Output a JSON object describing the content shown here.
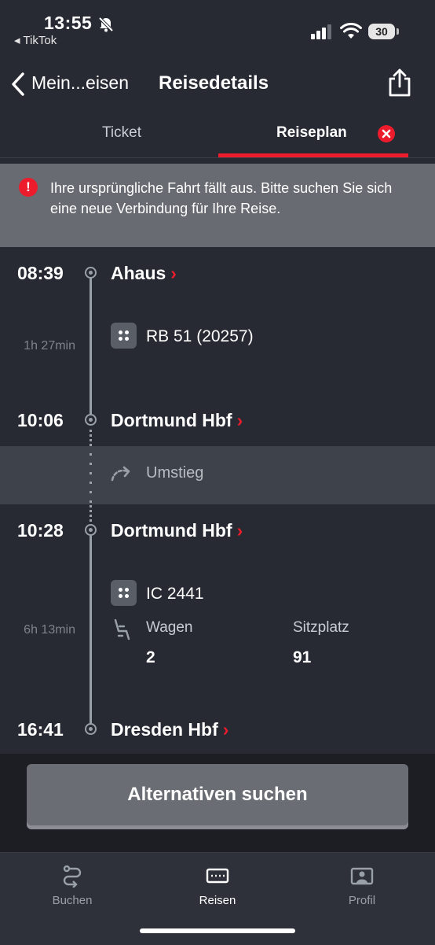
{
  "status_bar": {
    "time": "13:55",
    "back_app": "◂ TikTok",
    "battery": "30"
  },
  "header": {
    "back_label": "Mein...eisen",
    "title": "Reisedetails"
  },
  "tabs": [
    {
      "label": "Ticket"
    },
    {
      "label": "Reiseplan"
    }
  ],
  "alert": {
    "text": "Ihre ursprüngliche Fahrt fällt aus. Bitte suchen Sie sich eine neue Verbindung für Ihre Reise."
  },
  "journey": {
    "stops": [
      {
        "time": "08:39",
        "station": "Ahaus"
      },
      {
        "time": "10:06",
        "station": "Dortmund Hbf"
      },
      {
        "time": "10:28",
        "station": "Dortmund Hbf"
      },
      {
        "time": "16:41",
        "station": "Dresden Hbf"
      }
    ],
    "legs": [
      {
        "duration": "1h 27min",
        "train": "RB 51 (20257)"
      },
      {
        "duration": "6h 13min",
        "train": "IC 2441",
        "wagon_label": "Wagen",
        "wagon": "2",
        "seat_label": "Sitzplatz",
        "seat": "91"
      }
    ],
    "transfer_label": "Umstieg"
  },
  "action": {
    "button_label": "Alternativen suchen"
  },
  "tabbar": [
    {
      "label": "Buchen",
      "icon": "route-icon"
    },
    {
      "label": "Reisen",
      "icon": "ticket-icon"
    },
    {
      "label": "Profil",
      "icon": "profile-icon"
    }
  ],
  "colors": {
    "background": "#272a33",
    "accent": "#ec1c2d",
    "alert_bg": "#686b71",
    "button_bg": "#6a6d73"
  }
}
